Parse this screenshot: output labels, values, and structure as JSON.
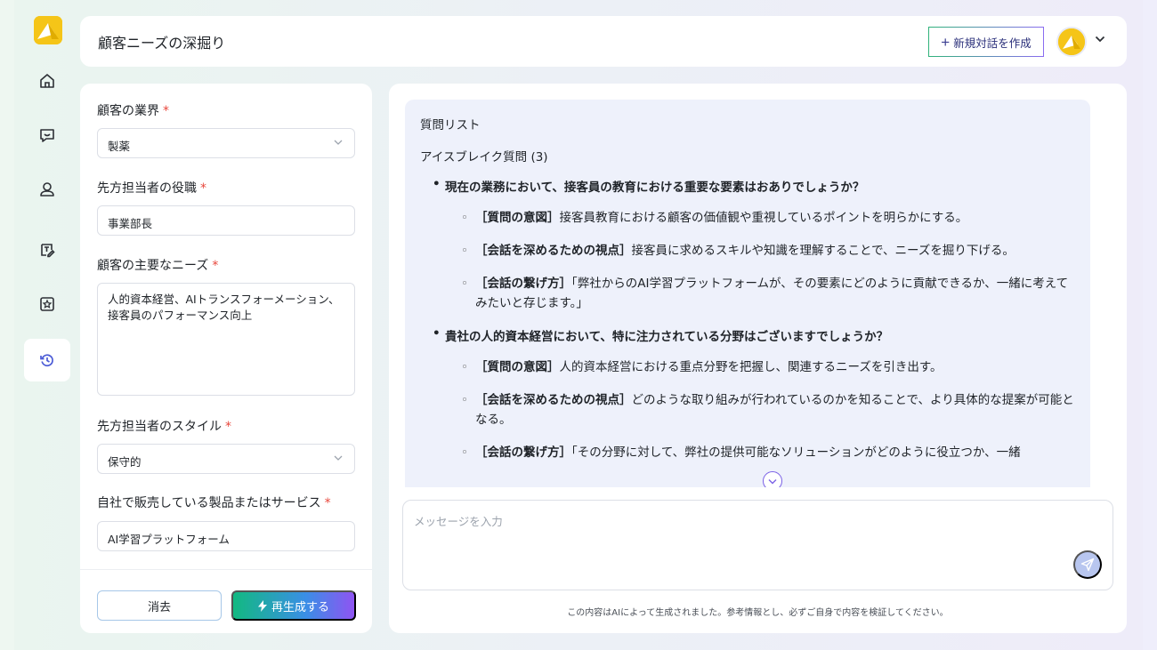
{
  "header": {
    "title": "顧客ニーズの深掘り",
    "new_chat_label": "新規対話を作成",
    "new_chat_icon": "plus-icon"
  },
  "rail": {
    "items": [
      {
        "name": "home",
        "icon": "home-icon"
      },
      {
        "name": "chat",
        "icon": "chat-icon"
      },
      {
        "name": "user",
        "icon": "user-icon"
      },
      {
        "name": "edit",
        "icon": "edit-icon"
      },
      {
        "name": "star",
        "icon": "star-box-icon"
      },
      {
        "name": "history",
        "icon": "history-icon",
        "active": true
      }
    ]
  },
  "form": {
    "industry": {
      "label": "顧客の業界",
      "required": "*",
      "value": "製薬"
    },
    "position": {
      "label": "先方担当者の役職",
      "required": "*",
      "value": "事業部長"
    },
    "needs": {
      "label": "顧客の主要なニーズ",
      "required": "*",
      "value": "人的資本経営、AIトランスフォーメーション、接客員のパフォーマンス向上"
    },
    "style": {
      "label": "先方担当者のスタイル",
      "required": "*",
      "value": "保守的"
    },
    "product": {
      "label": "自社で販売している製品またはサービス",
      "required": "*",
      "value": "AI学習プラットフォーム"
    },
    "clear_label": "消去",
    "regenerate_label": "再生成する"
  },
  "answer": {
    "heading": "質問リスト",
    "section": "アイスブレイク質問 (3)",
    "questions": [
      {
        "text": "現在の業務において、接客員の教育における重要な要素はおありでしょうか？",
        "subs": [
          {
            "tag": "［質問の意図］",
            "text": "接客員教育における顧客の価値観や重視しているポイントを明らかにする。"
          },
          {
            "tag": "［会話を深めるための視点］",
            "text": "接客員に求めるスキルや知識を理解することで、ニーズを掘り下げる。"
          },
          {
            "tag": "［会話の繋げ方］",
            "text": "「弊社からのAI学習プラットフォームが、その要素にどのように貢献できるか、一緒に考えてみたいと存じます。」"
          }
        ]
      },
      {
        "text": "貴社の人的資本経営において、特に注力されている分野はございますでしょうか？",
        "subs": [
          {
            "tag": "［質問の意図］",
            "text": "人的資本経営における重点分野を把握し、関連するニーズを引き出す。"
          },
          {
            "tag": "［会話を深めるための視点］",
            "text": "どのような取り組みが行われているのかを知ることで、より具体的な提案が可能となる。"
          },
          {
            "tag": "［会話の繋げ方］",
            "text": "「その分野に対して、弊社の提供可能なソリューションがどのように役立つか、一緒"
          }
        ]
      }
    ]
  },
  "chat": {
    "placeholder": "メッセージを入力",
    "disclaimer": "この内容はAIによって生成されました。参考情報とし、必ずご自身で内容を検証してください。"
  },
  "colors": {
    "accent_green": "#12b981",
    "accent_purple": "#8f54f2",
    "required_red": "#e8473c",
    "answer_bg": "#eef1fb",
    "logo_yellow": "#f5c518"
  }
}
